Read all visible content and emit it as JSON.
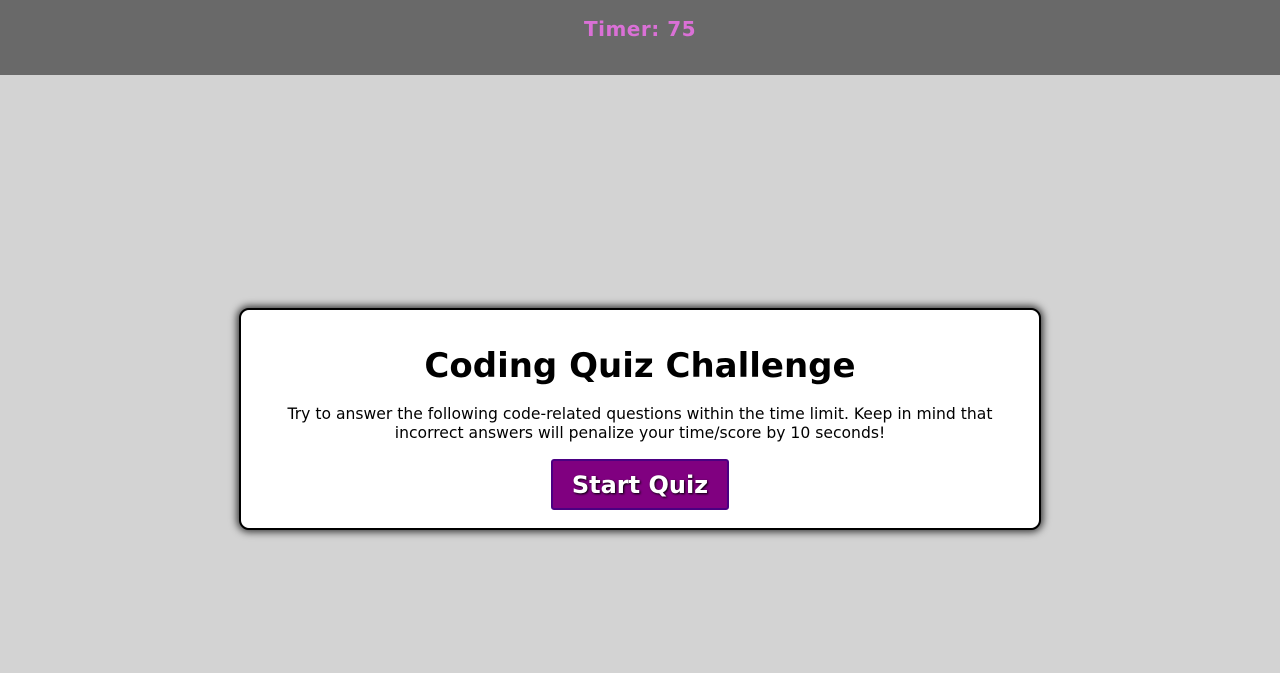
{
  "header": {
    "timer_label": "Timer: 75"
  },
  "intro_card": {
    "title": "Coding Quiz Challenge",
    "description": "Try to answer the following code-related questions within the time limit. Keep in mind that incorrect answers will penalize your time/score by 10 seconds!",
    "start_button_label": "Start Quiz"
  },
  "colors": {
    "page_background": "#d3d3d3",
    "header_background": "#696969",
    "timer_text": "#da70d6",
    "card_background": "#ffffff",
    "button_background": "#800080",
    "button_border": "#4b0082",
    "button_text": "#ffffff"
  }
}
